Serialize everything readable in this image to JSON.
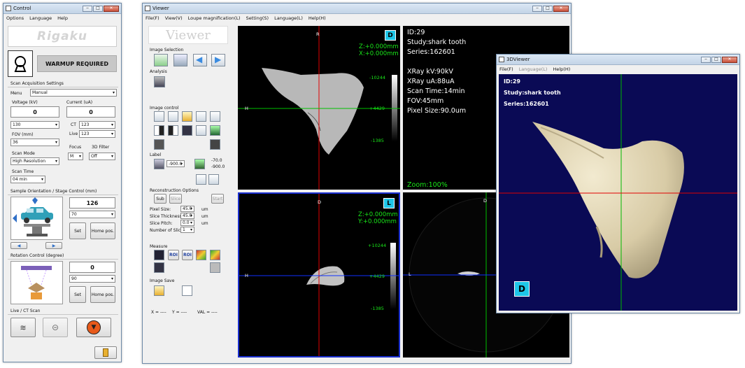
{
  "control": {
    "title": "Control",
    "menu": [
      "Options",
      "Language",
      "Help"
    ],
    "logo": "Rigaku",
    "warmup": "WARMUP REQUIRED",
    "scan_settings": "Scan Acquisition Settings",
    "menu_label": "Menu",
    "menu_value": "Manual",
    "voltage_label": "Voltage (kV)",
    "voltage_value": "0",
    "voltage_select": "130",
    "current_label": "Current (uA)",
    "current_value": "0",
    "ct_label": "CT",
    "ct_value": "123",
    "live_label": "Live",
    "live_value": "123",
    "fov_label": "FOV (mm)",
    "fov_value": "36",
    "focus_label": "Focus",
    "focus_value": "M",
    "filter_label": "3D Filter",
    "filter_value": "Off",
    "scan_mode_label": "Scan Mode",
    "scan_mode_value": "High Resolution",
    "scan_time_label": "Scan Time",
    "scan_time_value": "04 min",
    "stage_label": "Sample Orientation / Stage Control (mm)",
    "stage_value": "126",
    "stage_select": "70",
    "set": "Set",
    "home": "Home pos.",
    "rotation_label": "Rotation Control (degree)",
    "rotation_value": "0",
    "rotation_select": "90",
    "live_ct_label": "Live / CT Scan"
  },
  "viewer": {
    "title": "Viewer",
    "menu": [
      "File(F)",
      "View(V)",
      "Loupe magnification(L)",
      "Setting(S)",
      "Language(L)",
      "Help(H)"
    ],
    "logo": "Viewer",
    "image_selection": "Image Selection",
    "analysis": "Analysis",
    "image_control": "Image control",
    "label": "Label",
    "label_val1": "-900.0",
    "label_val2": "-70.0",
    "label_val3": "-900.0",
    "recon": "Reconstruction Options",
    "sub": "Sub",
    "slice": "Slice",
    "start": "Start",
    "pixel_size": "Pixel Size:",
    "pixel_size_v": "45.0",
    "slice_thick": "Slice Thickness:",
    "slice_thick_v": "45.0",
    "slice_pitch": "Slice Pitch:",
    "slice_pitch_v": "0.0",
    "num_slices": "Number of Slices:",
    "num_slices_v": "1",
    "unit": "um",
    "measure": "Measure",
    "roi1": "ROI",
    "roi2": "ROI",
    "image_save": "Image Save",
    "xlabel": "X = ----",
    "ylabel": "Y = ----",
    "vallabel": "VAL = ----",
    "vp1": {
      "letter": "D",
      "top": "R",
      "left": "H",
      "z": "Z:+0.000mm",
      "x": "X:+0.000mm",
      "max": "-10244",
      "mid": "+4429",
      "min": "-1385"
    },
    "vp2": {
      "letter": "L",
      "top": "D",
      "left": "H",
      "z": "Z:+0.000mm",
      "y": "Y:+0.000mm",
      "max": "+10244",
      "mid": "+4429",
      "min": "-1385"
    },
    "vp4": {
      "top": "D",
      "left": "L"
    },
    "info": {
      "id": "ID:29",
      "study": "Study:shark tooth",
      "series": "Series:162601",
      "kv": "XRay kV:90kV",
      "ua": "XRay uA:88uA",
      "time": "Scan Time:14min",
      "fov": "FOV:45mm",
      "pixel": "Pixel Size:90.0um",
      "zoom": "Zoom:100%"
    }
  },
  "viewer3d": {
    "title": "3DViewer",
    "menu": [
      "File(F)",
      "Language(L)",
      "Help(H)"
    ],
    "id": "ID:29",
    "study": "Study:shark tooth",
    "series": "Series:162601",
    "letter": "D"
  }
}
